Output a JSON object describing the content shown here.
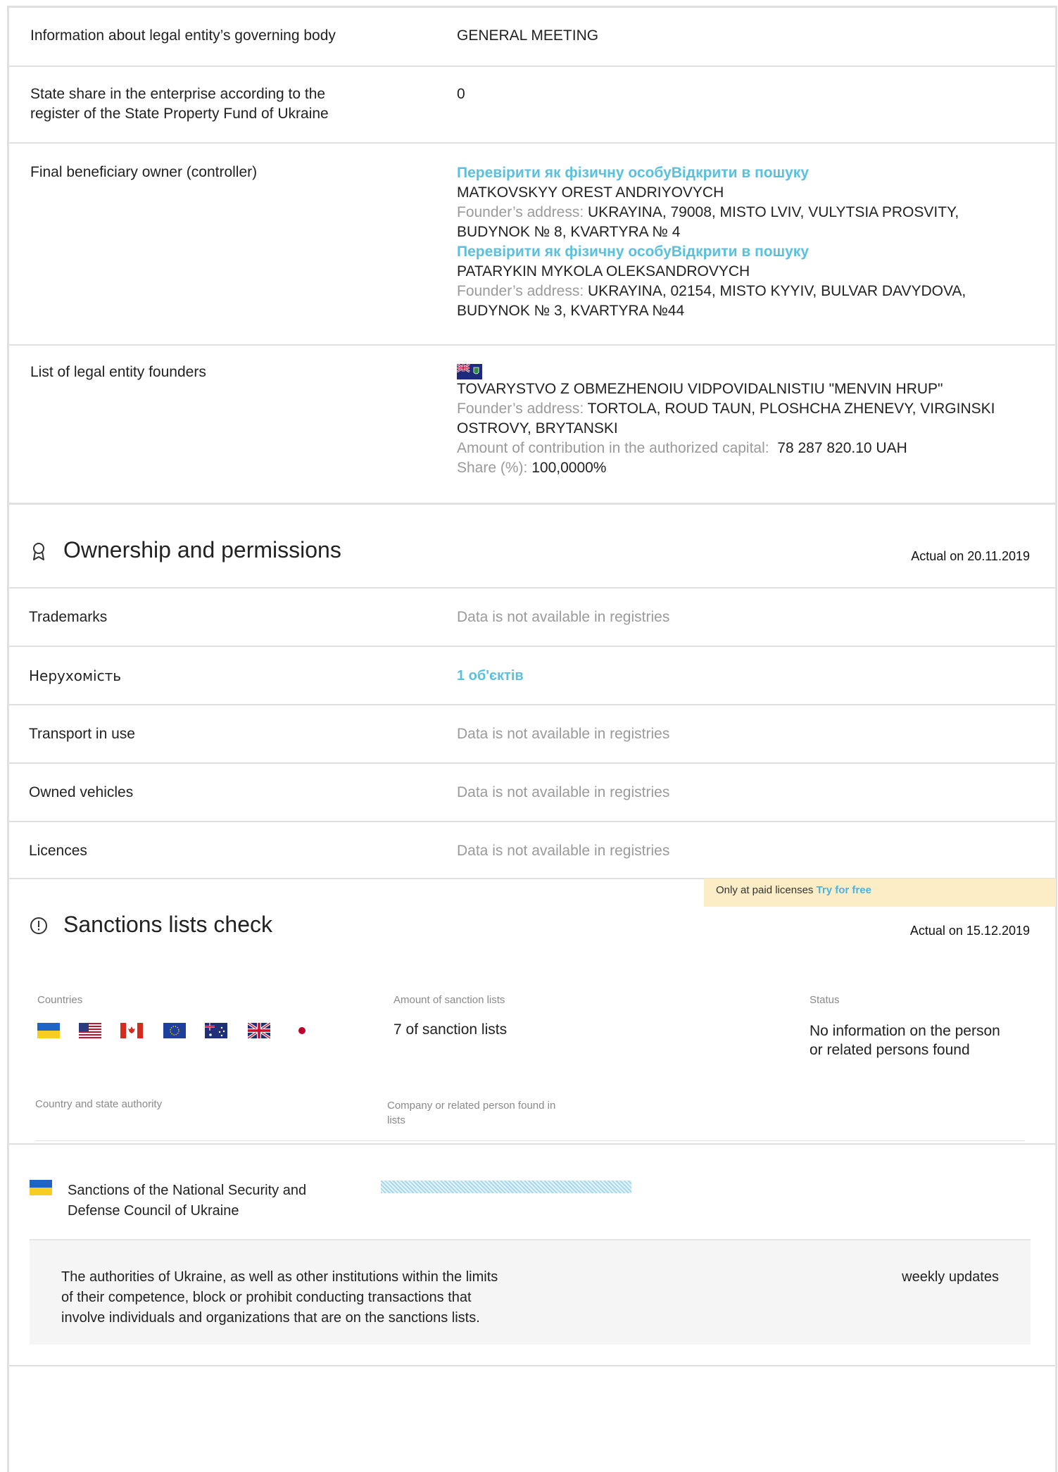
{
  "info_rows": [
    {
      "label": "Information about legal entity’s governing body",
      "value": "GENERAL MEETING"
    },
    {
      "label_line1": "State share in the enterprise according to the",
      "label_line2": "register of the State Property Fund of Ukraine",
      "value": "0"
    }
  ],
  "beneficiary": {
    "label": "Final beneficiary owner (controller)",
    "owners": [
      {
        "link": "Перевірити як фізичну особуВідкрити в пошуку",
        "name": "MATKOVSKYY OREST ANDRIYOVYCH",
        "address_label": "Founder’s address:",
        "address_line1": "UKRAYINA, 79008, MISTO LVIV, VULYTSIA PROSVITY,",
        "address_line2": "BUDYNOK № 8, KVARTYRA № 4"
      },
      {
        "link": "Перевірити як фізичну особуВідкрити в пошуку",
        "name": "PATARYKIN MYKOLA OLEKSANDROVYCH",
        "address_label": "Founder’s address:",
        "address_line1": "UKRAYINA, 02154, MISTO KYYIV, BULVAR DAVYDOVA,",
        "address_line2": "BUDYNOK № 3, KVARTYRA №44"
      }
    ]
  },
  "founders": {
    "label": "List of legal entity founders",
    "flag_icon": "british-virgin-islands-flag",
    "name": "TOVARYSTVO Z OBMEZHENOIU VIDPOVIDALNISTIU \"MENVIN HRUP\"",
    "address_label": "Founder’s address:",
    "address_line1": "TORTOLA, ROUD TAUN, PLOSHCHA ZHENEVY, VIRGINSKI",
    "address_line2": "OSTROVY, BRYTANSKI",
    "contribution_label": "Amount of contribution in the authorized capital:",
    "contribution_value": "78 287 820.10 UAH",
    "share_label": "Share (%):",
    "share_value": "100,0000%"
  },
  "ownership": {
    "icon": "award-icon",
    "title": "Ownership and permissions",
    "actual": "Actual on 20.11.2019",
    "rows": [
      {
        "label": "Trademarks",
        "value": "Data is not available in registries",
        "kind": "muted"
      },
      {
        "label": "Нерухомість",
        "value": "1 об'єктів",
        "kind": "link"
      },
      {
        "label": "Transport in use",
        "value": "Data is not available in registries",
        "kind": "muted"
      },
      {
        "label": "Owned vehicles",
        "value": "Data is not available in registries",
        "kind": "muted"
      },
      {
        "label": "Licences",
        "value": "Data is not available in registries",
        "kind": "muted"
      }
    ]
  },
  "paid_banner": {
    "text": "Only at paid licenses",
    "link": "Try for free"
  },
  "sanctions": {
    "icon": "alert-circle-icon",
    "title": "Sanctions lists check",
    "actual": "Actual on 15.12.2019",
    "headers": {
      "countries": "Countries",
      "amount": "Amount of sanction lists",
      "status": "Status"
    },
    "flags": [
      "ukraine-flag",
      "usa-flag",
      "canada-flag",
      "eu-flag",
      "australia-flag",
      "uk-flag",
      "japan-flag"
    ],
    "amount": "7 of sanction lists",
    "status_line1": "No information on the person",
    "status_line2": "or related persons found",
    "table_headers": {
      "authority": "Country and state authority",
      "found_line1": "Company or related person found in",
      "found_line2": "lists"
    },
    "entry": {
      "flag_icon": "ukraine-flag",
      "name_line1": "Sanctions of the National Security and",
      "name_line2": "Defense Council of Ukraine"
    },
    "description": {
      "line1": "The authorities of Ukraine, as well as other institutions within the limits",
      "line2": "of their competence, block or prohibit conducting transactions that",
      "line3": "involve individuals and organizations that are on the sanctions lists.",
      "frequency": "weekly updates"
    }
  }
}
